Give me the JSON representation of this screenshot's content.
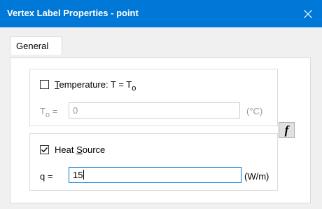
{
  "window": {
    "title": "Vertex Label Properties - point",
    "close_icon": "close-icon"
  },
  "tabs": [
    {
      "label": "General",
      "selected": true
    }
  ],
  "temperature": {
    "checked": false,
    "label_underlined": "T",
    "label_rest": "emperature: T = T",
    "label_sub": "o",
    "field_label": "T",
    "field_label_sub": "o",
    "field_label_eq": " =",
    "value": "0",
    "unit": "(°C)"
  },
  "heat_source": {
    "checked": true,
    "label_before": "Heat ",
    "label_underlined": "S",
    "label_after": "ource",
    "field_label": "q =",
    "value": "15",
    "unit": "(W/m)"
  },
  "function_button": {
    "label": "f"
  },
  "colors": {
    "titlebar": "#0078d7",
    "focus_border": "#0078d7",
    "disabled_text": "#9a9a9a"
  }
}
